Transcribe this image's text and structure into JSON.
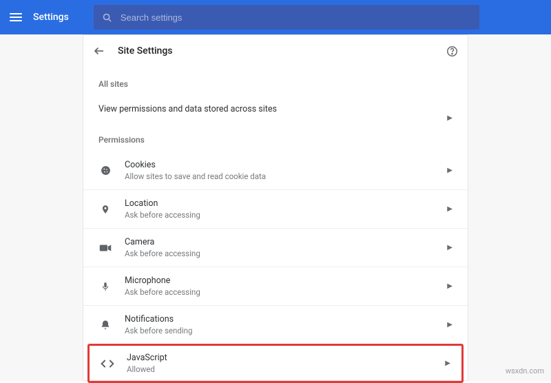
{
  "header": {
    "app_title": "Settings",
    "search_placeholder": "Search settings"
  },
  "page": {
    "title": "Site Settings",
    "all_sites_label": "All sites",
    "all_sites_row": "View permissions and data stored across sites",
    "permissions_label": "Permissions",
    "items": [
      {
        "icon": "cookie",
        "title": "Cookies",
        "sub": "Allow sites to save and read cookie data"
      },
      {
        "icon": "location",
        "title": "Location",
        "sub": "Ask before accessing"
      },
      {
        "icon": "camera",
        "title": "Camera",
        "sub": "Ask before accessing"
      },
      {
        "icon": "mic",
        "title": "Microphone",
        "sub": "Ask before accessing"
      },
      {
        "icon": "bell",
        "title": "Notifications",
        "sub": "Ask before sending"
      },
      {
        "icon": "code",
        "title": "JavaScript",
        "sub": "Allowed"
      }
    ]
  },
  "watermark": "wsxdn.com"
}
